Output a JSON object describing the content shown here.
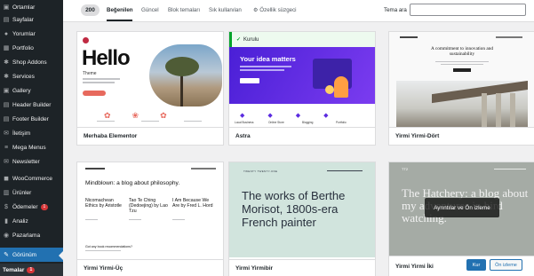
{
  "sidebar": {
    "items": [
      {
        "label": "Ortamlar",
        "icon": "media-icon"
      },
      {
        "label": "Sayfalar",
        "icon": "pages-icon"
      },
      {
        "label": "Yorumlar",
        "icon": "comments-icon"
      },
      {
        "label": "Portfolio",
        "icon": "portfolio-icon"
      },
      {
        "label": "Shop Addons",
        "icon": "shop-icon"
      },
      {
        "label": "Services",
        "icon": "services-icon"
      },
      {
        "label": "Gallery",
        "icon": "gallery-icon"
      },
      {
        "label": "Header Builder",
        "icon": "header-icon"
      },
      {
        "label": "Footer Builder",
        "icon": "footer-icon"
      },
      {
        "label": "İletişim",
        "icon": "contact-icon"
      },
      {
        "label": "Mega Menus",
        "icon": "menu-icon"
      },
      {
        "label": "Newsletter",
        "icon": "newsletter-icon"
      },
      {
        "label": "WooCommerce",
        "icon": "woocommerce-icon"
      },
      {
        "label": "Ürünler",
        "icon": "products-icon"
      },
      {
        "label": "Ödemeler",
        "icon": "payments-icon",
        "badge": "1"
      },
      {
        "label": "Analiz",
        "icon": "analytics-icon"
      },
      {
        "label": "Pazarlama",
        "icon": "marketing-icon"
      }
    ],
    "active": {
      "label": "Görünüm",
      "icon": "appearance-icon"
    },
    "submenu": {
      "label": "Temalar",
      "badge": "1"
    }
  },
  "toolbar": {
    "count": "200",
    "tabs": [
      "Beğenilen",
      "Güncel",
      "Blok temaları",
      "Sık kullanılan"
    ],
    "filter_label": "Özellik süzgeci",
    "search_label": "Tema ara",
    "search_value": ""
  },
  "themes": [
    {
      "name": "Merhaba Elementor",
      "preview": {
        "heading": "Hello",
        "sub": "Theme"
      }
    },
    {
      "name": "Astra",
      "status": "Kurulu",
      "preview": {
        "heading": "Your idea matters",
        "features": [
          "Local Business",
          "Online Store",
          "Blogging",
          "Portfolio"
        ]
      }
    },
    {
      "name": "Yirmi Yirmi-Dört",
      "preview": {
        "heading": "A commitment to innovation and sustainability"
      }
    },
    {
      "name": "Yirmi Yirmi-Üç",
      "preview": {
        "heading": "Mindblown: a blog about philosophy.",
        "posts": [
          "Nicomachean Ethics by Aristotle",
          "Tao Te Ching (Dedoejing) by Lao Tzu",
          "I Am Because We Are by Fred L. Hord"
        ],
        "footer": "Got any book recommendations?"
      }
    },
    {
      "name": "Yirmi Yirmibir",
      "preview": {
        "kicker": "TWENTY TWENTY-ONE",
        "heading": "The works of Berthe Morisot, 1800s-era French painter"
      }
    },
    {
      "name": "Yirmi Yirmi İki",
      "preview": {
        "logo": "TT2",
        "heading": "The Hatchery: a blog about my adventures in bird watching."
      },
      "overlay": "Ayrıntılar ve Ön izleme",
      "install": "Kur",
      "preview_btn": "Ön izleme"
    }
  ],
  "colors": {
    "sidebar_bg": "#1d2327",
    "accent": "#2271b1",
    "badge": "#d63638",
    "astra_purple": "#5b2be0",
    "installed_green": "#00a32a",
    "tt1_green": "#d1e4dd",
    "tt2_bg": "#a5aba5"
  }
}
